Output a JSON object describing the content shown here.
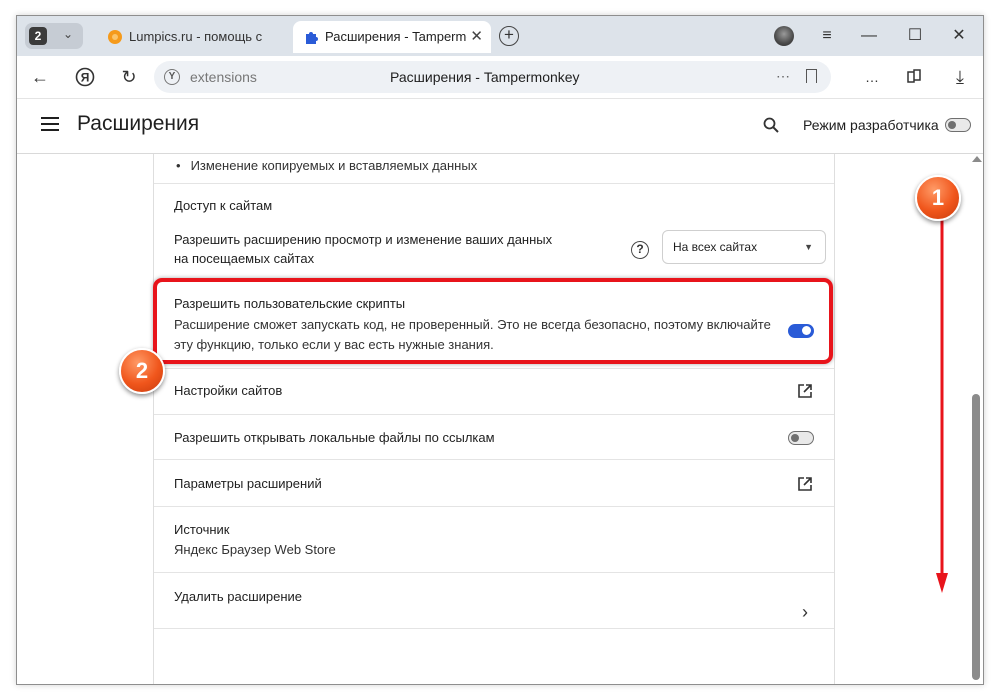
{
  "tabs": {
    "count": "2",
    "inactive_title": "Lumpics.ru - помощь с кон",
    "active_title": "Расширения - Tampermonkey"
  },
  "toolbar": {
    "url": "extensions",
    "page_title": "Расширения - Tampermonkey"
  },
  "header": {
    "title": "Расширения",
    "dev_mode_label": "Режим разработчика",
    "dev_mode_enabled": false
  },
  "content": {
    "permission_item": "Изменение копируемых и вставляемых данных",
    "site_access": {
      "heading": "Доступ к сайтам",
      "line1": "Разрешить расширению просмотр и изменение ваших данных",
      "line2": "на посещаемых сайтах",
      "select_value": "На всех сайтах"
    },
    "user_scripts": {
      "title": "Разрешить пользовательские скрипты",
      "desc1": "Расширение сможет запускать код, не проверенный. Это не всегда безопасно, поэтому включайте",
      "desc2": "эту функцию, только если у вас есть нужные знания.",
      "enabled": true
    },
    "site_settings": "Настройки сайтов",
    "local_files": {
      "label": "Разрешить открывать локальные файлы по ссылкам",
      "enabled": false
    },
    "extension_options": "Параметры расширений",
    "source": {
      "label": "Источник",
      "value": "Яндекс Браузер Web Store"
    },
    "remove": "Удалить расширение"
  },
  "annotations": {
    "badge1": "1",
    "badge2": "2",
    "accent_color": "#e8141b"
  }
}
